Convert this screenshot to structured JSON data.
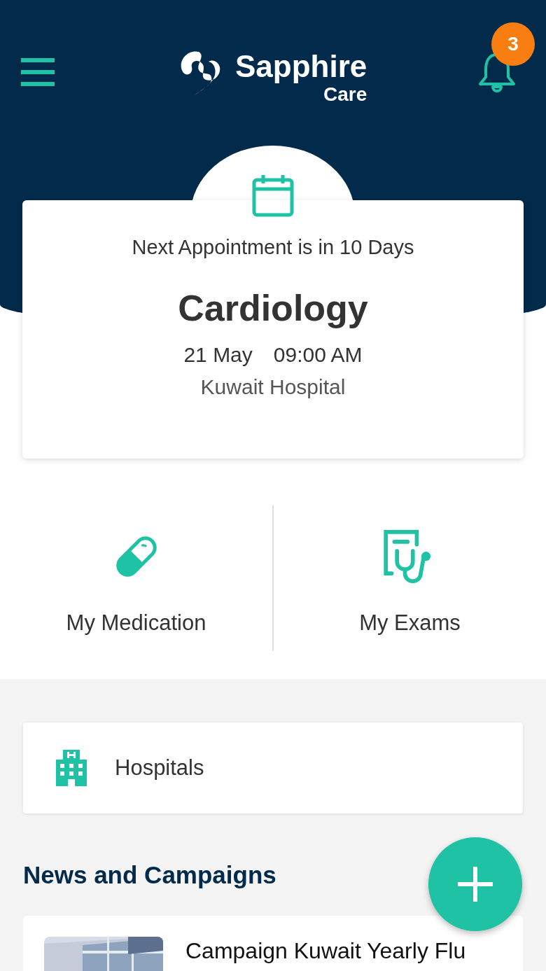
{
  "header": {
    "notification_count": "3"
  },
  "logo": {
    "name": "Sapphire",
    "sub": "Care"
  },
  "appointment": {
    "heading": "Next Appointment is in 10 Days",
    "specialty": "Cardiology",
    "date": "21 May",
    "time": "09:00 AM",
    "location": "Kuwait Hospital"
  },
  "quick_actions": [
    {
      "label": "My Medication",
      "kind": "medication"
    },
    {
      "label": "My Exams",
      "kind": "exams"
    }
  ],
  "hospitals": {
    "label": "Hospitals"
  },
  "news": {
    "title": "News and Campaigns",
    "items": [
      {
        "title": "Campaign Kuwait Yearly Flu"
      }
    ]
  }
}
